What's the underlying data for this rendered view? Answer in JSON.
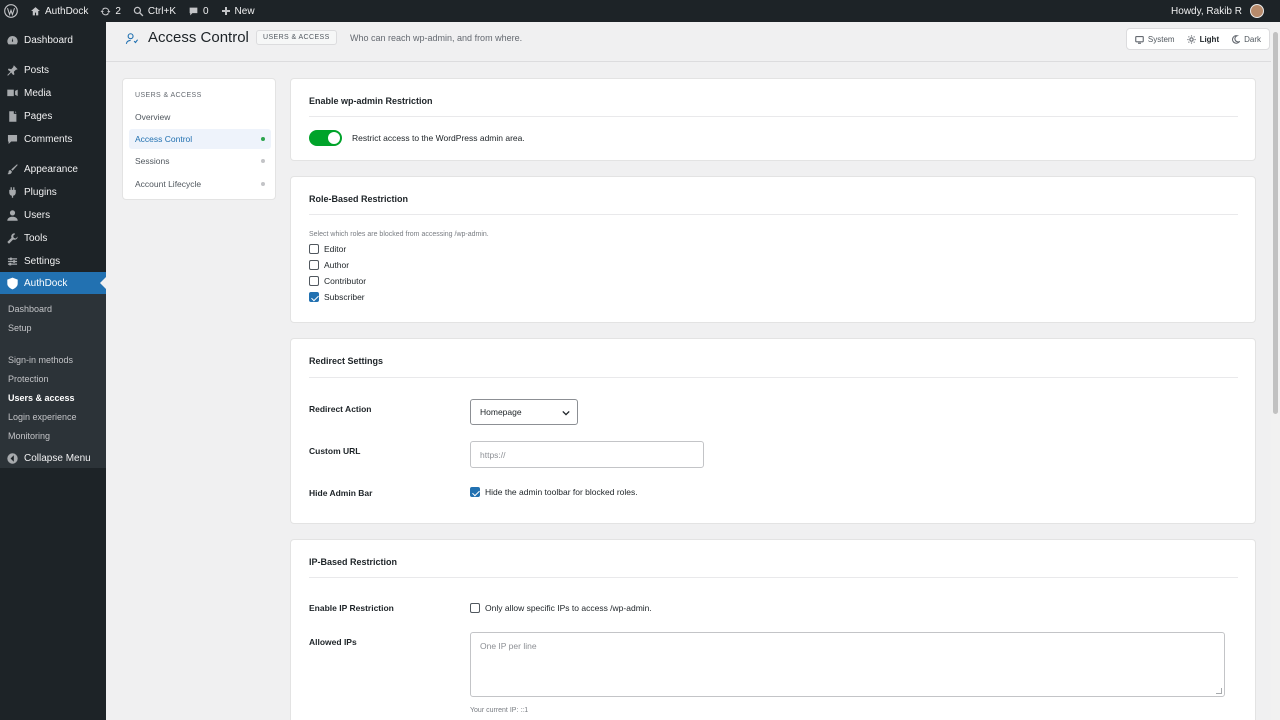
{
  "adminbar": {
    "site_name": "AuthDock",
    "updates_count": "2",
    "search_shortcut": "Ctrl+K",
    "comments_count": "0",
    "new_label": "New",
    "greeting": "Howdy, Rakib R"
  },
  "sidebar": {
    "items": [
      {
        "label": "Dashboard",
        "icon": "dashboard-icon"
      },
      {
        "label": "Posts",
        "icon": "pin-icon"
      },
      {
        "label": "Media",
        "icon": "media-icon"
      },
      {
        "label": "Pages",
        "icon": "pages-icon"
      },
      {
        "label": "Comments",
        "icon": "comment-icon"
      },
      {
        "label": "Appearance",
        "icon": "brush-icon"
      },
      {
        "label": "Plugins",
        "icon": "plugin-icon"
      },
      {
        "label": "Users",
        "icon": "users-icon"
      },
      {
        "label": "Tools",
        "icon": "wrench-icon"
      },
      {
        "label": "Settings",
        "icon": "settings-icon"
      },
      {
        "label": "AuthDock",
        "icon": "shield-icon"
      }
    ],
    "submenu": [
      "Dashboard",
      "Setup",
      "Sign-in methods",
      "Protection",
      "Users & access",
      "Login experience",
      "Monitoring"
    ],
    "collapse_label": "Collapse Menu"
  },
  "header": {
    "title": "Access Control",
    "section": "USERS & ACCESS",
    "subtitle": "Who can reach wp-admin, and from where.",
    "theme_options": [
      "System",
      "Light",
      "Dark"
    ],
    "theme_selected": "Light"
  },
  "subnav": {
    "heading": "USERS & ACCESS",
    "items": [
      "Overview",
      "Access Control",
      "Sessions",
      "Account Lifecycle"
    ]
  },
  "wpadmin_restriction": {
    "title": "Enable wp-admin Restriction",
    "toggle_on": true,
    "toggle_label": "Restrict access to the WordPress admin area."
  },
  "role_restriction": {
    "title": "Role-Based Restriction",
    "hint": "Select which roles are blocked from accessing /wp-admin.",
    "roles": [
      {
        "label": "Editor",
        "checked": false
      },
      {
        "label": "Author",
        "checked": false
      },
      {
        "label": "Contributor",
        "checked": false
      },
      {
        "label": "Subscriber",
        "checked": true
      }
    ]
  },
  "redirect_settings": {
    "title": "Redirect Settings",
    "action_label": "Redirect Action",
    "action_value": "Homepage",
    "custom_url_label": "Custom URL",
    "custom_url_placeholder": "https://",
    "hide_bar_label": "Hide Admin Bar",
    "hide_bar_checked": true,
    "hide_bar_text": "Hide the admin toolbar for blocked roles."
  },
  "ip_restriction": {
    "title": "IP-Based Restriction",
    "enable_label": "Enable IP Restriction",
    "enable_checked": false,
    "enable_text": "Only allow specific IPs to access /wp-admin.",
    "allowed_label": "Allowed IPs",
    "allowed_placeholder": "One IP per line",
    "current_ip": "Your current IP: ::1"
  },
  "colors": {
    "accent": "#2271b1",
    "success": "#00a32a",
    "sidebar_bg": "#1d2327"
  }
}
